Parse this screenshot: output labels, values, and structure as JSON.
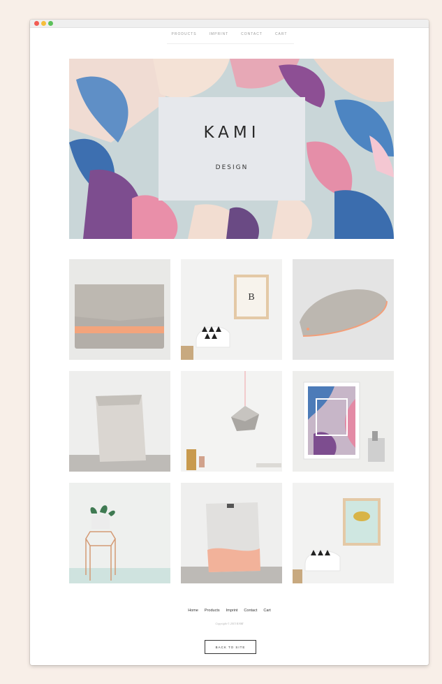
{
  "window": {
    "traffic_lights": [
      "close",
      "minimize",
      "zoom"
    ]
  },
  "topnav": {
    "items": [
      "PRODUCTS",
      "IMPRINT",
      "CONTACT",
      "CART"
    ]
  },
  "hero": {
    "title": "KAMI",
    "subtitle": "DESIGN"
  },
  "products": [
    {
      "name": "grey-felt-clutch-orange-strap"
    },
    {
      "name": "lay-back-framed-print-chair"
    },
    {
      "name": "grey-felt-glasses-case"
    },
    {
      "name": "grey-paper-bag"
    },
    {
      "name": "concrete-pendant-lamp"
    },
    {
      "name": "hello-floral-framed-print"
    },
    {
      "name": "plant-on-copper-hexagon-stand"
    },
    {
      "name": "dip-dyed-coral-paper-bag"
    },
    {
      "name": "gold-cloud-framed-print-chair"
    }
  ],
  "footer": {
    "links": [
      "Home",
      "Products",
      "Imprint",
      "Contact",
      "Cart"
    ],
    "copyright": "Copyright © 2015 KAMI",
    "back_button": "BACK TO SITE"
  },
  "colors": {
    "page_bg": "#f8efe8",
    "window_bg": "#ffffff",
    "hero_box": "#e6e8ec",
    "text_dark": "#2a2a2a",
    "nav_gray": "#9a9a9a"
  }
}
